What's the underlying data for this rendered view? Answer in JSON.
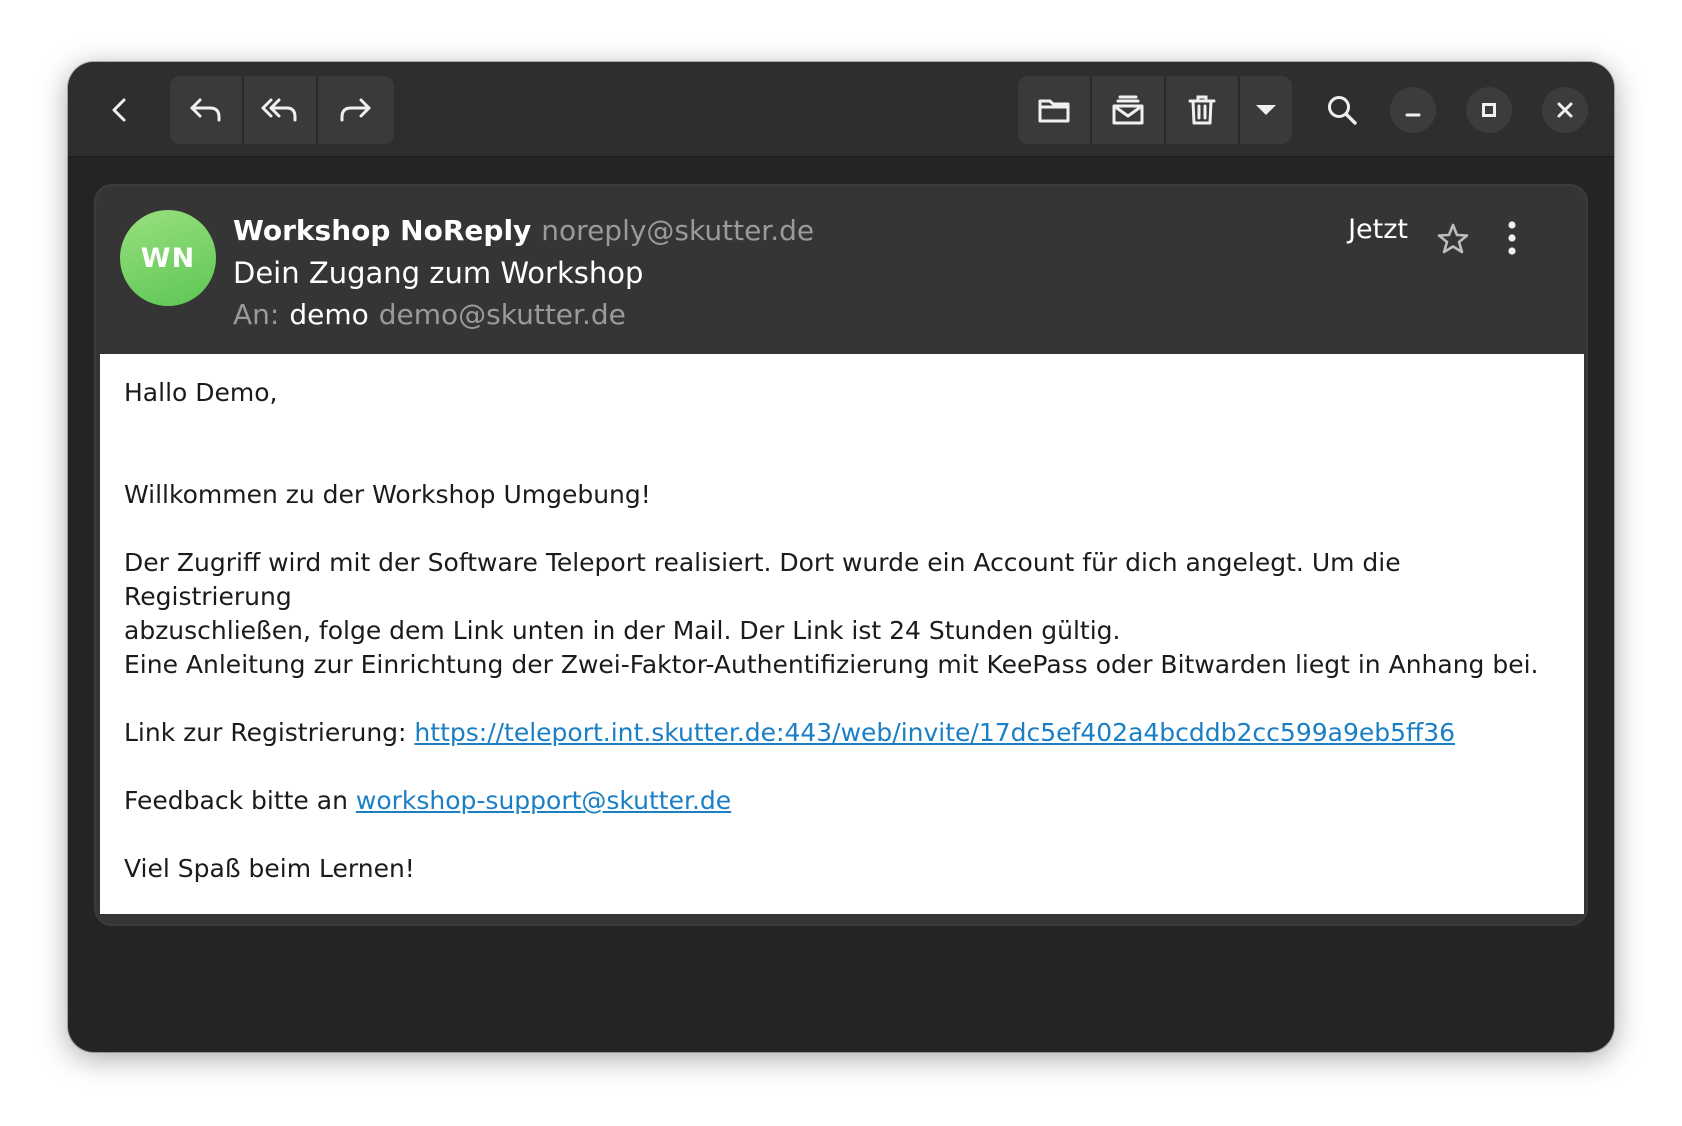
{
  "toolbar": {
    "back_icon": "go-back-icon",
    "reply_icon": "reply-icon",
    "reply_all_icon": "reply-all-icon",
    "forward_icon": "forward-icon",
    "move_icon": "folder-icon",
    "junk_icon": "junk-mail-icon",
    "trash_icon": "trash-icon",
    "more_icon": "dropdown-arrow-icon",
    "search_icon": "search-icon"
  },
  "window_controls": {
    "minimize_icon": "minimize-icon",
    "maximize_icon": "maximize-icon",
    "close_icon": "close-icon"
  },
  "message": {
    "avatar_initials": "WN",
    "avatar_color": "#6dcf5e",
    "sender_name": "Workshop NoReply",
    "sender_email": "noreply@skutter.de",
    "subject": "Dein Zugang zum Workshop",
    "to_label": "An:",
    "to_name": "demo",
    "to_email": "demo@skutter.de",
    "date": "Jetzt"
  },
  "body": {
    "greeting": "Hallo Demo,",
    "welcome": "Willkommen zu der Workshop Umgebung!",
    "paragraph1_line1": "Der Zugriff wird mit der Software Teleport realisiert. Dort wurde ein Account für dich angelegt. Um die Registrierung",
    "paragraph1_line2": "abzuschließen, folge dem Link unten in der Mail. Der Link ist 24 Stunden gültig.",
    "paragraph1_line3": "Eine Anleitung zur Einrichtung der Zwei-Faktor-Authentifizierung mit KeePass oder Bitwarden liegt in Anhang bei.",
    "link_label": "Link zur Registrierung: ",
    "link_url": "https://teleport.int.skutter.de:443/web/invite/17dc5ef402a4bcddb2cc599a9eb5ff36",
    "feedback_label": "Feedback bitte an ",
    "feedback_email": "workshop-support@skutter.de",
    "closing": "Viel Spaß beim Lernen!"
  },
  "colors": {
    "window_bg": "#242424",
    "header_bg": "#2e2e2e",
    "link": "#1a7fc4"
  }
}
